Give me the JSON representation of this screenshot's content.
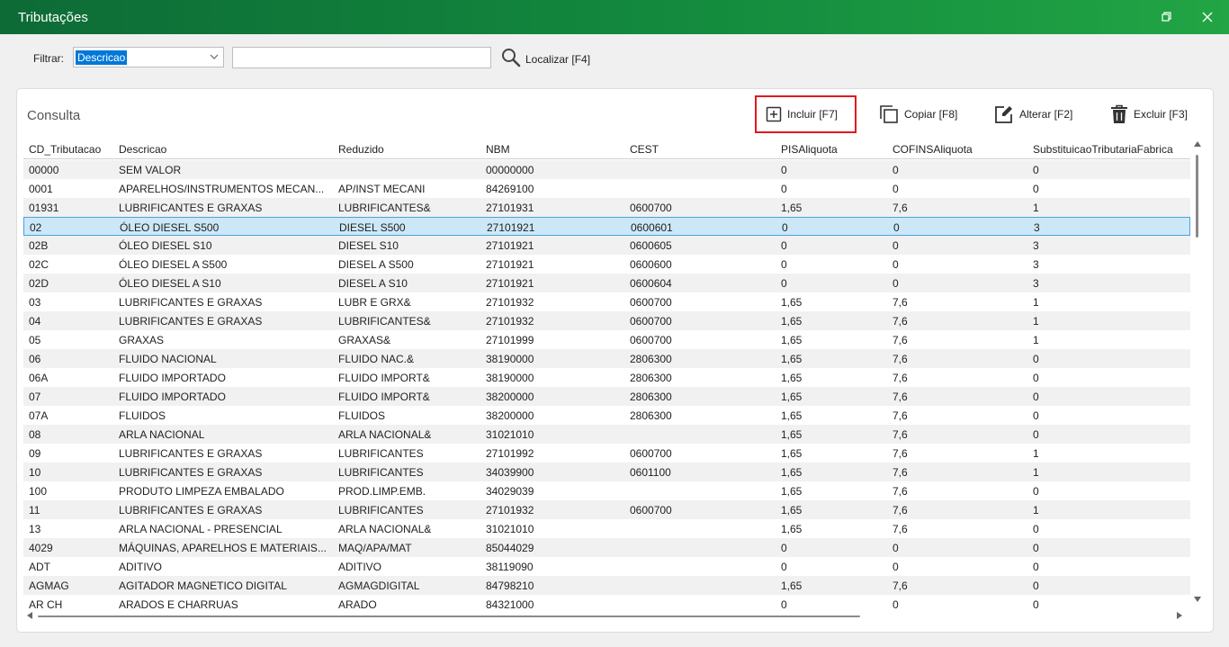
{
  "window": {
    "title": "Tributações",
    "maximize_icon": "restore-icon",
    "close_icon": "close-icon"
  },
  "filter": {
    "label": "Filtrar:",
    "selected": "Descricao",
    "search_value": "",
    "locate_label": "Localizar [F4]"
  },
  "panel": {
    "title": "Consulta"
  },
  "toolbar": {
    "incluir": "Incluir [F7]",
    "copiar": "Copiar [F8]",
    "alterar": "Alterar [F2]",
    "excluir": "Excluir [F3]"
  },
  "colors": {
    "titlebar_start": "#0d6b36",
    "titlebar_end": "#22a545",
    "highlight_border": "#e0191e",
    "selection": "#cce8f8"
  },
  "table": {
    "columns": [
      "CD_Tributacao",
      "Descricao",
      "Reduzido",
      "NBM",
      "CEST",
      "PISAliquota",
      "COFINSAliquota",
      "SubstituicaoTributariaFabrica"
    ],
    "selected_row": 3,
    "rows": [
      [
        "00000",
        "SEM VALOR",
        "",
        "00000000",
        "",
        "0",
        "0",
        "0"
      ],
      [
        "0001",
        "APARELHOS/INSTRUMENTOS MECAN...",
        "AP/INST MECANI",
        "84269100",
        "",
        "0",
        "0",
        "0"
      ],
      [
        "01931",
        "LUBRIFICANTES E GRAXAS",
        "LUBRIFICANTES&",
        "27101931",
        "0600700",
        "1,65",
        "7,6",
        "1"
      ],
      [
        "02",
        "ÓLEO DIESEL S500",
        "DIESEL S500",
        "27101921",
        "0600601",
        "0",
        "0",
        "3"
      ],
      [
        "02B",
        "ÓLEO DIESEL S10",
        "DIESEL S10",
        "27101921",
        "0600605",
        "0",
        "0",
        "3"
      ],
      [
        "02C",
        "ÓLEO DIESEL A S500",
        "DIESEL A S500",
        "27101921",
        "0600600",
        "0",
        "0",
        "3"
      ],
      [
        "02D",
        "ÓLEO DIESEL A S10",
        "DIESEL A S10",
        "27101921",
        "0600604",
        "0",
        "0",
        "3"
      ],
      [
        "03",
        "LUBRIFICANTES E GRAXAS",
        "LUBR E GRX&",
        "27101932",
        "0600700",
        "1,65",
        "7,6",
        "1"
      ],
      [
        "04",
        "LUBRIFICANTES E GRAXAS",
        "LUBRIFICANTES&",
        "27101932",
        "0600700",
        "1,65",
        "7,6",
        "1"
      ],
      [
        "05",
        "GRAXAS",
        "GRAXAS&",
        "27101999",
        "0600700",
        "1,65",
        "7,6",
        "1"
      ],
      [
        "06",
        "FLUIDO NACIONAL",
        "FLUIDO NAC.&",
        "38190000",
        "2806300",
        "1,65",
        "7,6",
        "0"
      ],
      [
        "06A",
        "FLUIDO IMPORTADO",
        "FLUIDO IMPORT&",
        "38190000",
        "2806300",
        "1,65",
        "7,6",
        "0"
      ],
      [
        "07",
        "FLUIDO IMPORTADO",
        "FLUIDO IMPORT&",
        "38200000",
        "2806300",
        "1,65",
        "7,6",
        "0"
      ],
      [
        "07A",
        "FLUIDOS",
        "FLUIDOS",
        "38200000",
        "2806300",
        "1,65",
        "7,6",
        "0"
      ],
      [
        "08",
        "ARLA NACIONAL",
        "ARLA NACIONAL&",
        "31021010",
        "",
        "1,65",
        "7,6",
        "0"
      ],
      [
        "09",
        "LUBRIFICANTES E GRAXAS",
        "LUBRIFICANTES",
        "27101992",
        "0600700",
        "1,65",
        "7,6",
        "1"
      ],
      [
        "10",
        "LUBRIFICANTES E GRAXAS",
        "LUBRIFICANTES",
        "34039900",
        "0601100",
        "1,65",
        "7,6",
        "1"
      ],
      [
        "100",
        "PRODUTO LIMPEZA EMBALADO",
        "PROD.LIMP.EMB.",
        "34029039",
        "",
        "1,65",
        "7,6",
        "0"
      ],
      [
        "11",
        "LUBRIFICANTES E GRAXAS",
        "LUBRIFICANTES",
        "27101932",
        "0600700",
        "1,65",
        "7,6",
        "1"
      ],
      [
        "13",
        "ARLA NACIONAL - PRESENCIAL",
        "ARLA NACIONAL&",
        "31021010",
        "",
        "1,65",
        "7,6",
        "0"
      ],
      [
        "4029",
        "MÁQUINAS, APARELHOS E MATERIAIS...",
        "MAQ/APA/MAT",
        "85044029",
        "",
        "0",
        "0",
        "0"
      ],
      [
        "ADT",
        "ADITIVO",
        "ADITIVO",
        "38119090",
        "",
        "0",
        "0",
        "0"
      ],
      [
        "AGMAG",
        "AGITADOR MAGNETICO DIGITAL",
        "AGMAGDIGITAL",
        "84798210",
        "",
        "1,65",
        "7,6",
        "0"
      ],
      [
        "AR CH",
        "ARADOS E CHARRUAS",
        "ARADO",
        "84321000",
        "",
        "0",
        "0",
        "0"
      ]
    ]
  }
}
